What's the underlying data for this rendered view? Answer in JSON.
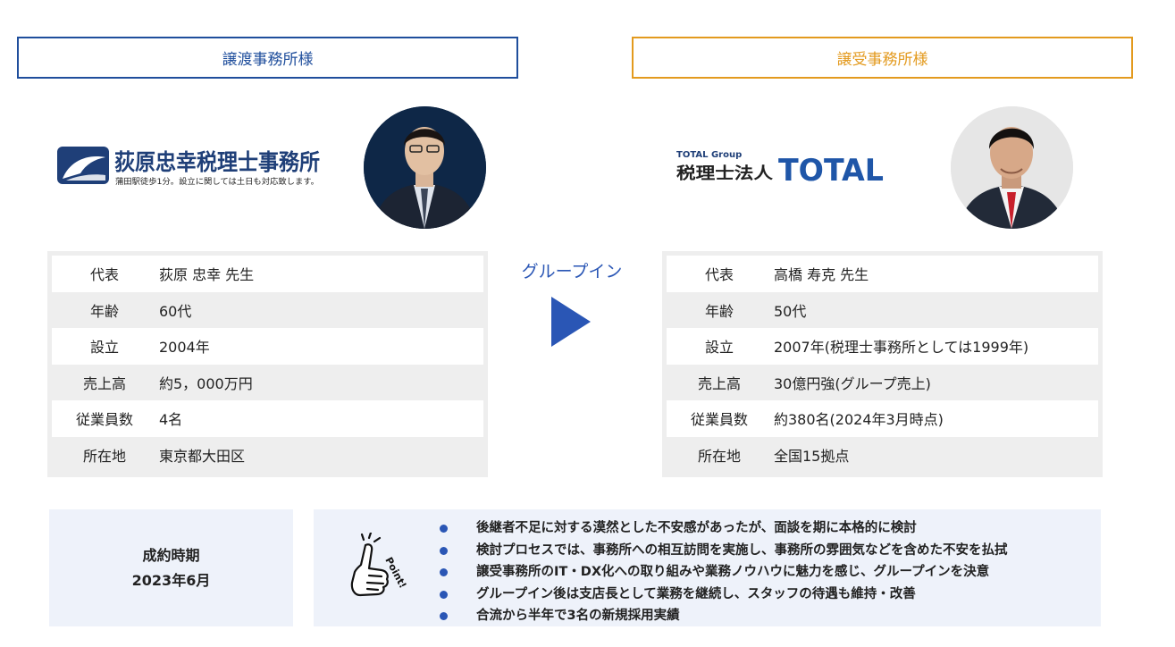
{
  "transferor": {
    "title": "譲渡事務所様",
    "logo": {
      "name": "荻原忠幸税理士事務所",
      "tagline": "蒲田駅徒歩1分。設立に関しては土日も対応致します。"
    },
    "rows": [
      {
        "label": "代表",
        "value": "荻原 忠幸 先生"
      },
      {
        "label": "年齢",
        "value": "60代"
      },
      {
        "label": "設立",
        "value": "2004年"
      },
      {
        "label": "売上高",
        "value": "約5，000万円"
      },
      {
        "label": "従業員数",
        "value": "4名"
      },
      {
        "label": "所在地",
        "value": "東京都大田区"
      }
    ]
  },
  "transferee": {
    "title": "譲受事務所様",
    "logo": {
      "group": "TOTAL Group",
      "name": "税理士法人",
      "brand": "TOTAL"
    },
    "rows": [
      {
        "label": "代表",
        "value": "高橋 寿克 先生"
      },
      {
        "label": "年齢",
        "value": "50代"
      },
      {
        "label": "設立",
        "value": "2007年(税理士事務所としては1999年)"
      },
      {
        "label": "売上高",
        "value": "30億円強(グループ売上)"
      },
      {
        "label": "従業員数",
        "value": "約380名(2024年3月時点)"
      },
      {
        "label": "所在地",
        "value": "全国15拠点"
      }
    ]
  },
  "center": {
    "label": "グループイン"
  },
  "closing": {
    "label": "成約時期",
    "value": "2023年6月"
  },
  "point": {
    "badge": "Point!",
    "items": [
      "後継者不足に対する漠然とした不安感があったが、面談を期に本格的に検討",
      "検討プロセスでは、事務所への相互訪問を実施し、事務所の雰囲気などを含めた不安を払拭",
      "譲受事務所のIT・DX化への取り組みや業務ノウハウに魅力を感じ、グループインを決意",
      "グループイン後は支店長として業務を継続し、スタッフの待遇も維持・改善",
      "合流から半年で3名の新規採用実績"
    ]
  },
  "colors": {
    "left_accent": "#1f4e9c",
    "right_accent": "#e39a1e",
    "arrow": "#2a56b5"
  }
}
